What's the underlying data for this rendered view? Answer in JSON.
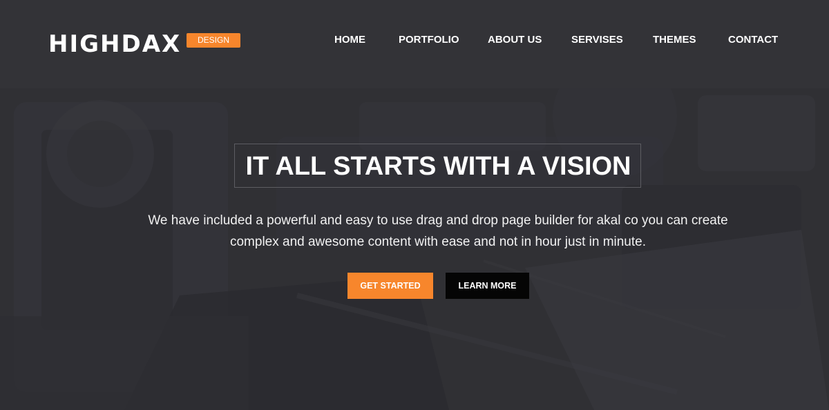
{
  "header": {
    "logo_text": "HIGHDAX",
    "logo_badge": "DESIGN",
    "nav_items": [
      {
        "label": "HOME"
      },
      {
        "label": "PORTFOLIO"
      },
      {
        "label": "ABOUT US"
      },
      {
        "label": "SERVISES"
      },
      {
        "label": "THEMES"
      },
      {
        "label": "CONTACT"
      }
    ]
  },
  "hero": {
    "title": "IT ALL STARTS WITH A VISION",
    "description_lines": [
      "We have included a powerful and easy to use drag and drop page builder for akal co you can create",
      "complex and awesome content with ease and not in hour just in minute."
    ],
    "buttons": {
      "primary_label": "GET STARTED",
      "secondary_label": "LEARN MORE"
    }
  },
  "colors": {
    "accent": "#f7862c",
    "header_background": "#333337",
    "hero_background": "#303034",
    "secondary_button": "#050505",
    "text": "#ffffff"
  }
}
